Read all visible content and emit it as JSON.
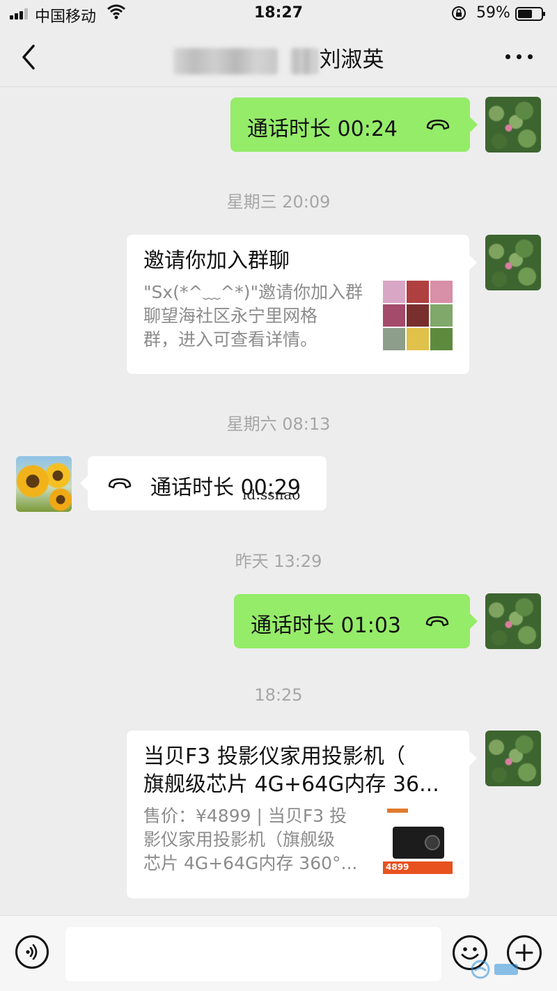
{
  "status_bar": {
    "carrier": "中国移动",
    "time": "18:27",
    "battery_percent": "59%"
  },
  "nav": {
    "title_visible": "刘淑英"
  },
  "messages": [
    {
      "side": "right",
      "type": "call",
      "text": "通话时长 00:24"
    },
    {
      "type": "timestamp",
      "text": "星期三 20:09"
    },
    {
      "side": "right",
      "type": "card",
      "title": "邀请你加入群聊",
      "desc_lines": [
        "\"Sx(*^﹏^*)\"邀请你加入群",
        "聊望海社区永宁里网格",
        "群，进入可查看详情。"
      ]
    },
    {
      "type": "timestamp",
      "text": "星期六 08:13"
    },
    {
      "side": "left",
      "type": "call",
      "text": "通话时长 00:29"
    },
    {
      "type": "timestamp",
      "text": "昨天 13:29"
    },
    {
      "side": "right",
      "type": "call",
      "text": "通话时长 01:03"
    },
    {
      "type": "timestamp",
      "text": "18:25"
    },
    {
      "side": "right",
      "type": "card",
      "title_lines": [
        "当贝F3 投影仪家用投影机（",
        "旗舰级芯片 4G+64G内存 36..."
      ],
      "desc_lines": [
        "售价：¥4899 | 当贝F3 投",
        "影仪家用投影机（旗舰级",
        "芯片 4G+64G内存 360°..."
      ],
      "thumb_price": "4899"
    }
  ],
  "watermark": "id:ssnao",
  "colors": {
    "background": "#ededed",
    "sent_bubble": "#95ec69",
    "received_bubble": "#ffffff",
    "timestamp": "#a6a6a6"
  },
  "icons": [
    "signal-icon",
    "wifi-icon",
    "orientation-lock-icon",
    "battery-icon",
    "back-icon",
    "more-icon",
    "phone-hangup-icon",
    "voice-icon",
    "emoji-icon",
    "plus-icon"
  ]
}
